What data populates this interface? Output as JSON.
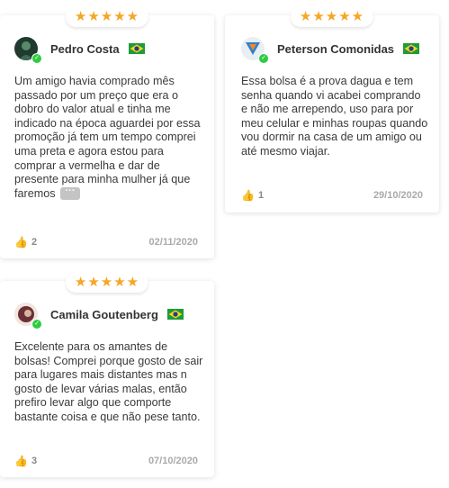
{
  "reviews": [
    {
      "stars": "★★★★★",
      "name": "Pedro Costa",
      "country": "Brasil",
      "text": "Um amigo havia comprado mês passado por um preço que era o dobro do valor atual e tinha me indicado na época aguardei por essa promoção já tem um tempo comprei uma preta e agora estou para comprar a vermelha e dar de presente para minha mulher já que faremos",
      "more_label": "···",
      "likes": "2",
      "date": "02/11/2020"
    },
    {
      "stars": "★★★★★",
      "name": "Peterson Comonidas",
      "country": "Brasil",
      "text": "Essa bolsa é a prova dagua e tem senha quando vi acabei comprando e não me arrependo, uso para por meu celular e minhas roupas quando vou dormir na casa de um amigo ou até mesmo viajar.",
      "likes": "1",
      "date": "29/10/2020"
    },
    {
      "stars": "★★★★★",
      "name": "Camila Goutenberg",
      "country": "Brasil",
      "text": "Excelente para os amantes de bolsas! Comprei porque gosto de sair para lugares mais distantes mas n gosto de levar várias malas, então prefiro levar algo que comporte bastante coisa e que não pese tanto.",
      "likes": "3",
      "date": "07/10/2020"
    }
  ],
  "icons": {
    "star": "star-icon",
    "thumb": "thumbs-up-icon",
    "verified": "verified-check-icon",
    "flag": "brazil-flag-icon"
  },
  "colors": {
    "star": "#f5a623",
    "verified": "#2ecc40",
    "text": "#3a3a3a",
    "muted": "#aaaaaa"
  },
  "glyphs": {
    "thumb": "👍",
    "check": "✓"
  }
}
